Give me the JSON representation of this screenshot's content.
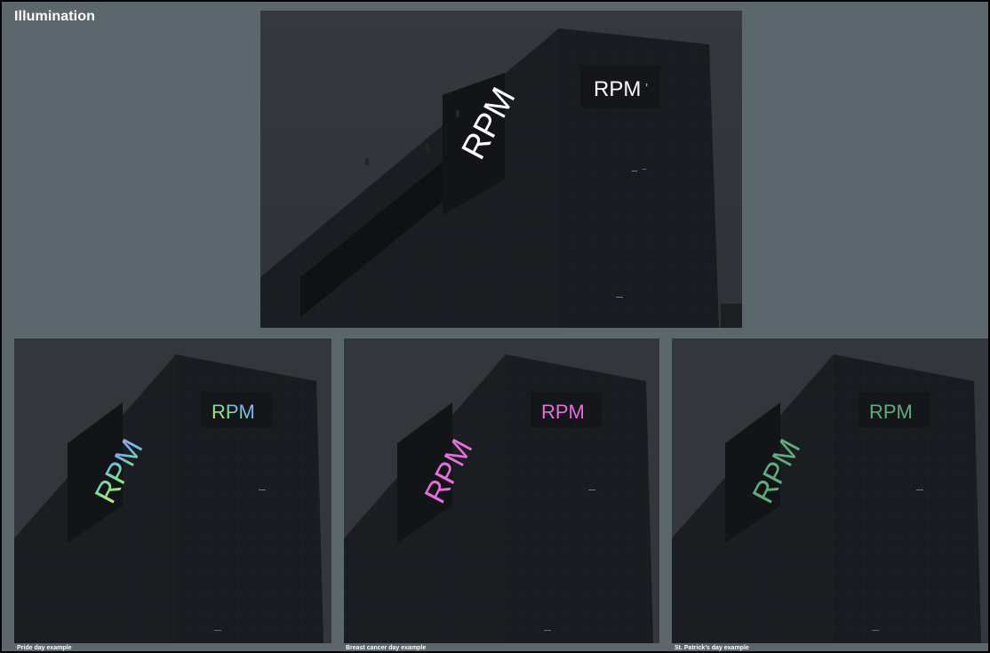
{
  "page": {
    "title": "Illumination",
    "background_color": "#5b666d"
  },
  "hero": {
    "logo_text": "RPM",
    "logo_color": "#ffffff"
  },
  "examples": [
    {
      "caption": "Pride day example",
      "logo_text": "RPM",
      "logo_colors": [
        "#f2e86b",
        "#7fe08f",
        "#6fb6f0",
        "#c79cf0"
      ]
    },
    {
      "caption": "Breast cancer day example",
      "logo_text": "RPM",
      "logo_colors": [
        "#e86ee0",
        "#e86ee0"
      ]
    },
    {
      "caption": "St. Patrick’s day example",
      "logo_text": "RPM",
      "logo_colors": [
        "#5fae7a",
        "#5fae7a"
      ]
    }
  ]
}
